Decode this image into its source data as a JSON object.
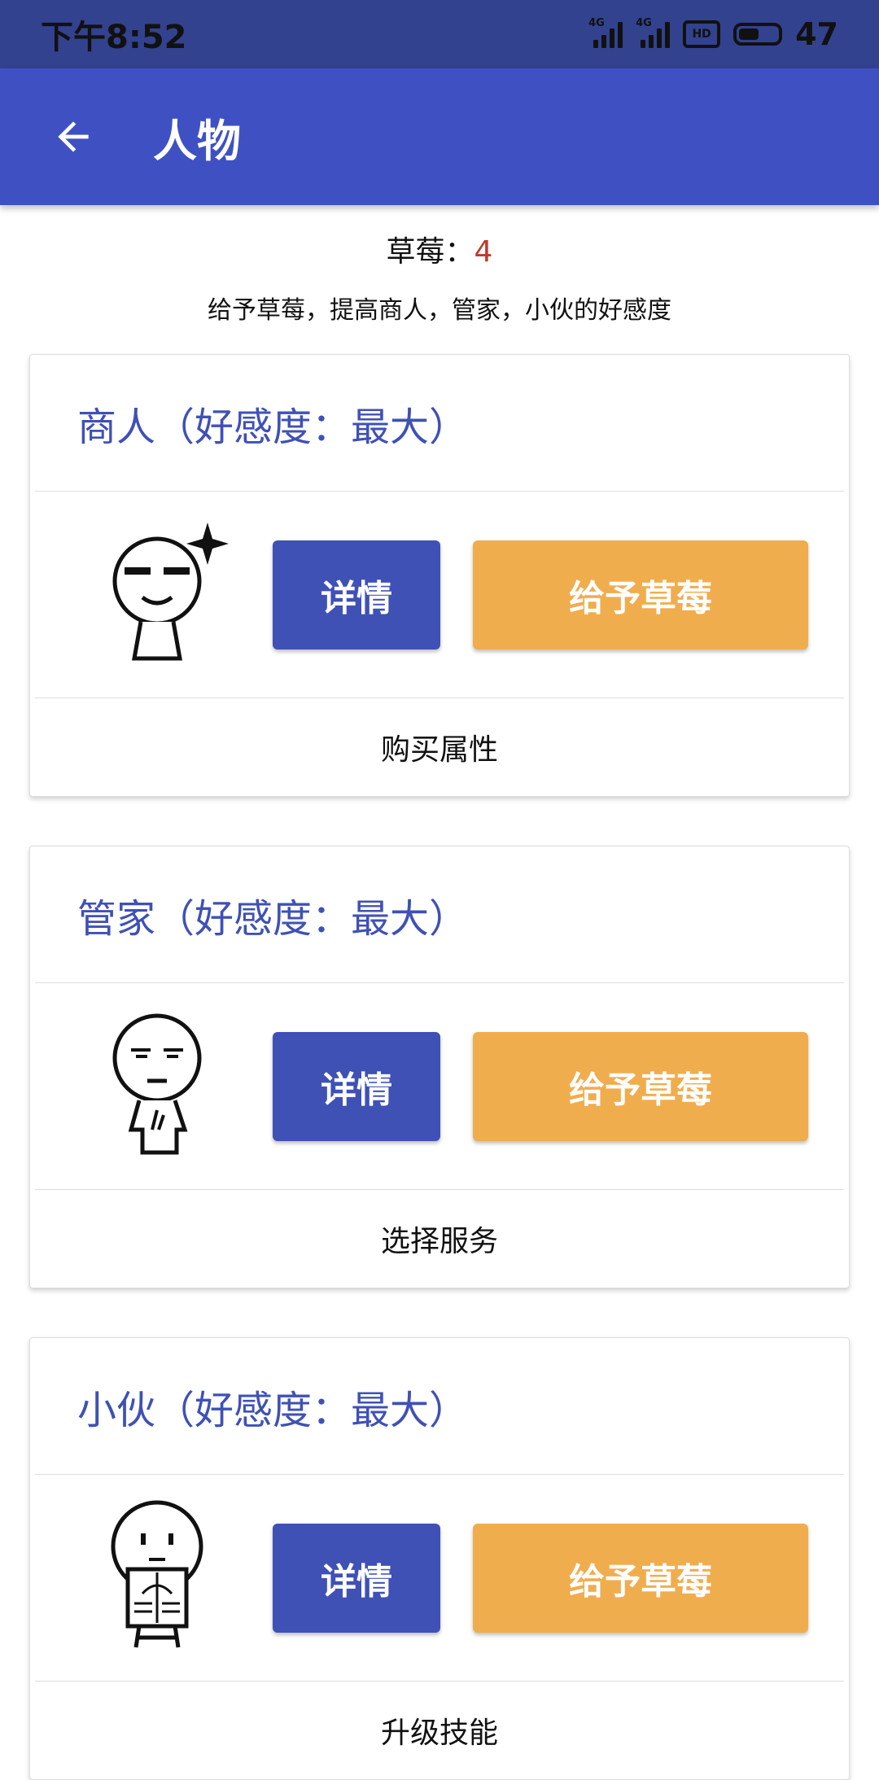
{
  "status": {
    "time": "下午8:52",
    "battery": "47",
    "signal1_tag": "4G",
    "signal2_tag": "4G",
    "hd_label": "HD"
  },
  "header": {
    "title": "人物",
    "back_icon": "arrow-left-icon"
  },
  "summary": {
    "label": "草莓：",
    "count": "4",
    "description": "给予草莓，提高商人，管家，小伙的好感度"
  },
  "cards": [
    {
      "title": "商人（好感度：最大）",
      "detail_label": "详情",
      "give_label": "给予草莓",
      "footer": "购买属性",
      "avatar": "merchant-avatar"
    },
    {
      "title": "管家（好感度：最大）",
      "detail_label": "详情",
      "give_label": "给予草莓",
      "footer": "选择服务",
      "avatar": "butler-avatar"
    },
    {
      "title": "小伙（好感度：最大）",
      "detail_label": "详情",
      "give_label": "给予草莓",
      "footer": "升级技能",
      "avatar": "lad-avatar"
    }
  ],
  "colors": {
    "primary": "#3f51b5",
    "accent": "#f0ad4e",
    "count": "#c0392b"
  }
}
